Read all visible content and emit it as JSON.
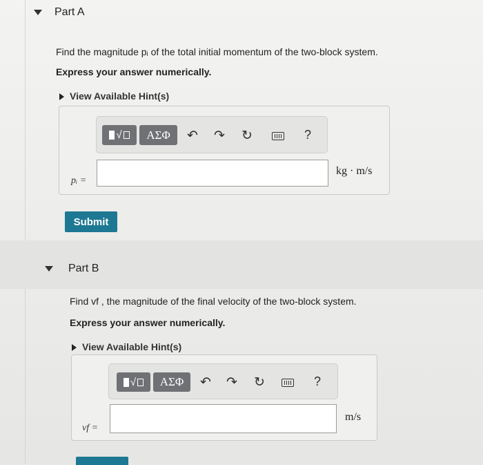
{
  "partA": {
    "title": "Part A",
    "question": "Find the magnitude pᵢ of the total initial momentum of the two-block system.",
    "instruction": "Express your answer numerically.",
    "hint_label": "View Available Hint(s)",
    "variable_label": "pᵢ =",
    "unit": "kg · m/s",
    "submit_label": "Submit",
    "input_value": ""
  },
  "partB": {
    "title": "Part B",
    "question": "Find vf , the magnitude of the final velocity of the two-block system.",
    "instruction": "Express your answer numerically.",
    "hint_label": "View Available Hint(s)",
    "variable_label": "vf =",
    "unit": "m/s",
    "input_value": ""
  },
  "toolbar": {
    "greek_label": "ΑΣΦ",
    "help_label": "?"
  }
}
